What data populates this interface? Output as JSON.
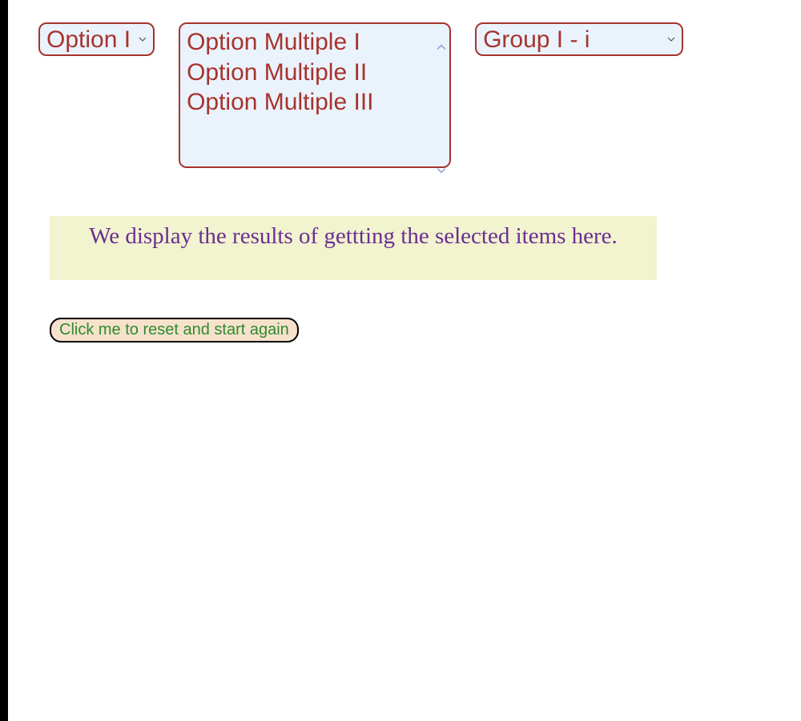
{
  "selects": {
    "single": {
      "selected": "Option I"
    },
    "multi": {
      "options": [
        "Option Multiple I",
        "Option Multiple II",
        "Option Multiple III"
      ]
    },
    "group": {
      "selected": "Group I - i"
    }
  },
  "result_text": "We display the results of gettting the selected items here.",
  "reset_button": "Click me to reset and start again"
}
